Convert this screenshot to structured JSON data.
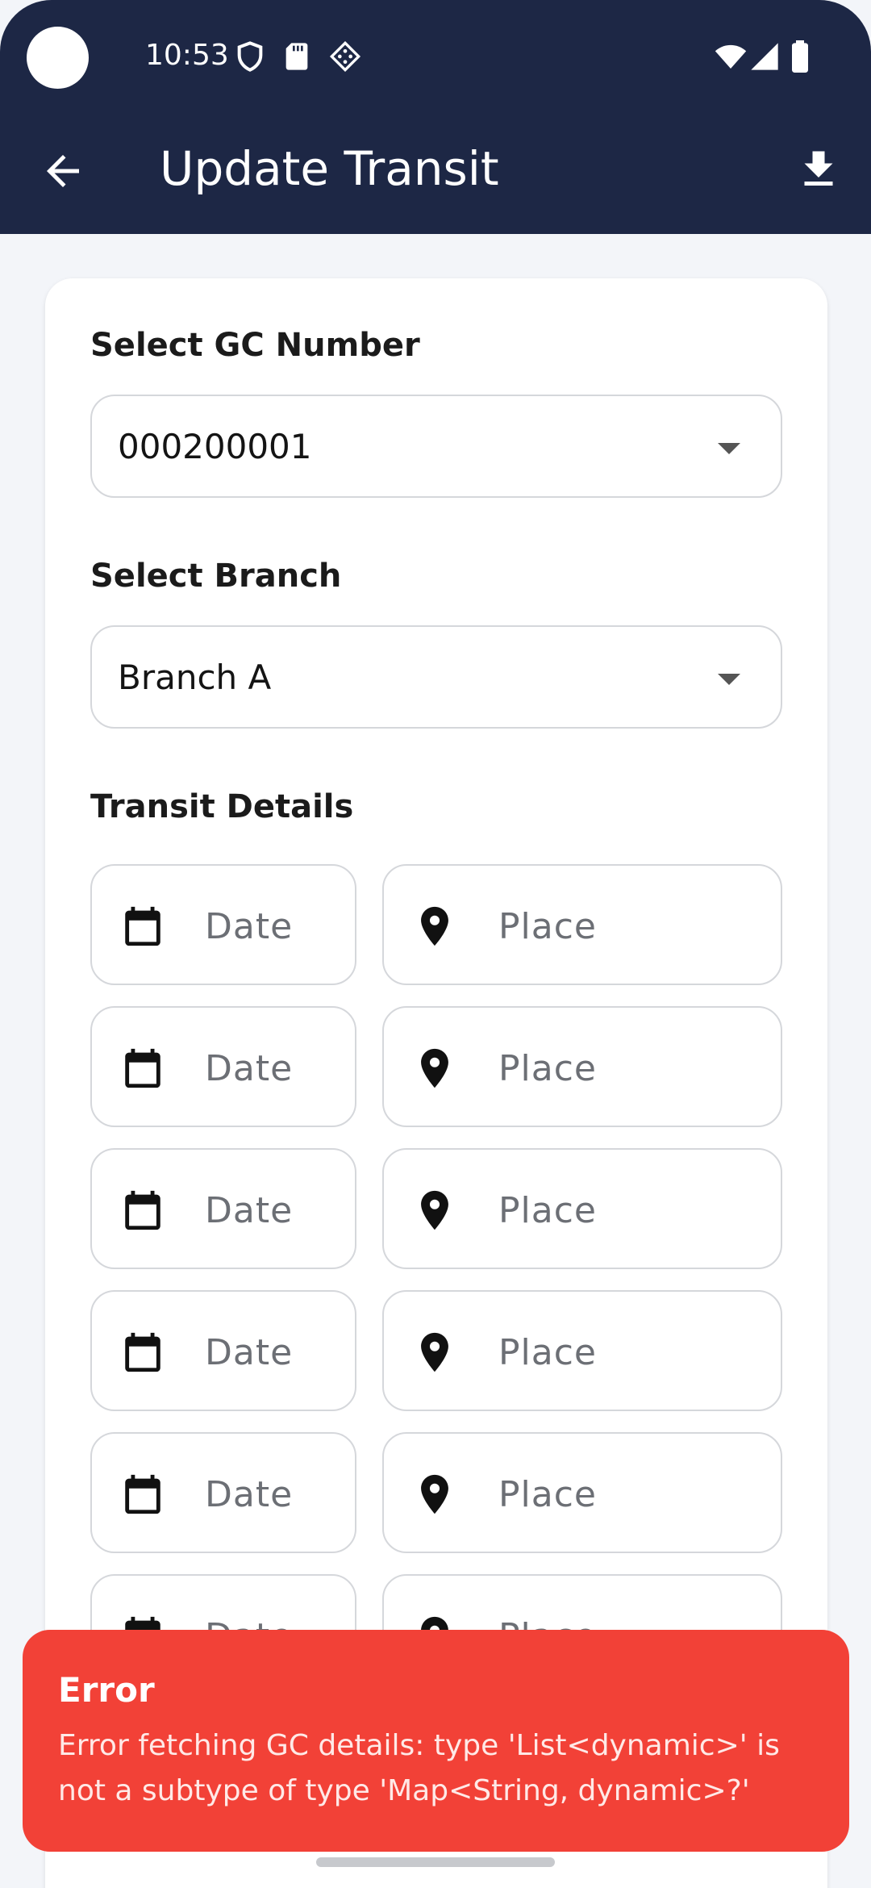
{
  "status_bar": {
    "time": "10:53",
    "left_icons": [
      "shield-icon",
      "sd-card-icon",
      "diamond-pattern-icon"
    ],
    "right_icons": [
      "wifi-icon",
      "signal-icon",
      "battery-icon"
    ]
  },
  "toolbar": {
    "title": "Update Transit",
    "back_icon": "arrow-back-icon",
    "action_icon": "download-icon"
  },
  "form": {
    "gc_label": "Select GC Number",
    "gc_value": "000200001",
    "branch_label": "Select Branch",
    "branch_value": "Branch A",
    "transit_label": "Transit Details",
    "rows": [
      {
        "date_placeholder": "Date",
        "place_placeholder": "Place"
      },
      {
        "date_placeholder": "Date",
        "place_placeholder": "Place"
      },
      {
        "date_placeholder": "Date",
        "place_placeholder": "Place"
      },
      {
        "date_placeholder": "Date",
        "place_placeholder": "Place"
      },
      {
        "date_placeholder": "Date",
        "place_placeholder": "Place"
      },
      {
        "date_placeholder": "Date",
        "place_placeholder": "Place"
      }
    ]
  },
  "snackbar": {
    "title": "Error",
    "message": "Error fetching GC details: type 'List<dynamic>' is not a subtype of type 'Map<String, dynamic>?'"
  },
  "colors": {
    "app_bar": "#1d2745",
    "background": "#f3f5f9",
    "error": "#f24137"
  }
}
